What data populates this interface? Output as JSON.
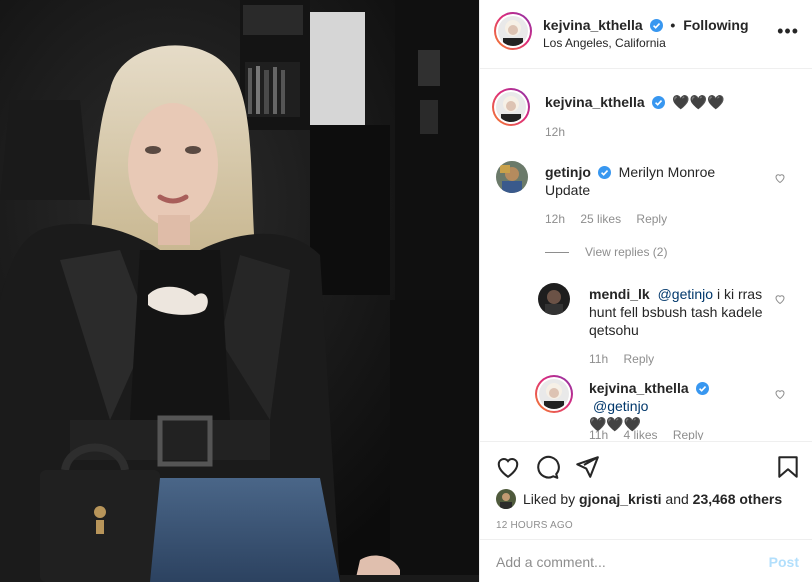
{
  "header": {
    "username": "kejvina_kthella",
    "separator": "•",
    "follow_label": "Following",
    "location": "Los Angeles, California",
    "more_label": "•••"
  },
  "caption": {
    "username": "kejvina_kthella",
    "text": "🖤🖤🖤",
    "time": "12h"
  },
  "comments": [
    {
      "username": "getinjo",
      "text": "Merilyn Monroe Update",
      "time": "12h",
      "likes": "25 likes",
      "reply_label": "Reply"
    }
  ],
  "view_replies_label": "View replies (2)",
  "replies": [
    {
      "username": "mendi_lk",
      "mention": "@getinjo",
      "text": " i ki rras hunt fell bsbush tash kadele qetsohu",
      "time": "11h",
      "reply_label": "Reply"
    },
    {
      "username": "kejvina_kthella",
      "mention": "@getinjo",
      "text": "🖤🖤🖤",
      "time": "11h",
      "likes": "4 likes",
      "reply_label": "Reply"
    }
  ],
  "likes_bar": {
    "prefix": "Liked by",
    "user": "gjonaj_kristi",
    "and": "and",
    "count": "23,468 others"
  },
  "time_ago": "12 HOURS AGO",
  "add_comment": {
    "placeholder": "Add a comment...",
    "post_label": "Post"
  },
  "colors": {
    "link": "#00376b",
    "verified": "#3897f0",
    "post_disabled": "#b2dffc",
    "muted": "#8e8e8e"
  },
  "icons": [
    "heart-icon",
    "comment-icon",
    "share-icon",
    "bookmark-icon",
    "verified-icon",
    "more-icon"
  ]
}
